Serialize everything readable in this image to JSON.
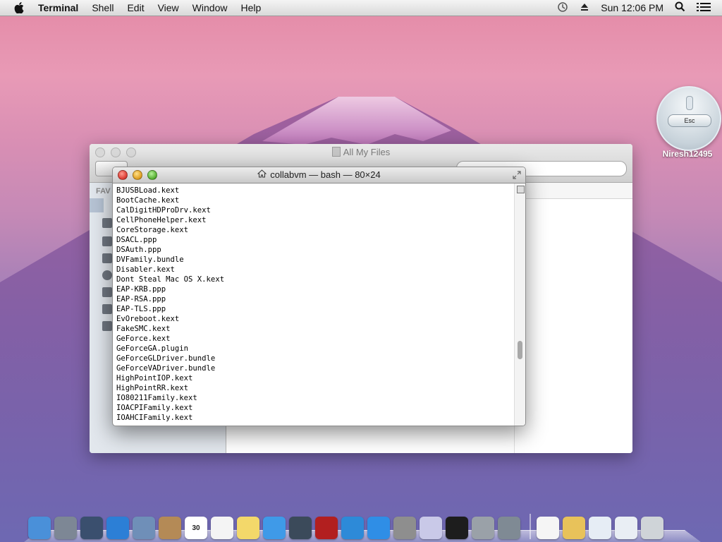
{
  "menubar": {
    "app_name": "Terminal",
    "menus": [
      "Shell",
      "Edit",
      "View",
      "Window",
      "Help"
    ],
    "clock": "Sun 12:06 PM",
    "icons": [
      "apple-icon",
      "time-machine-icon",
      "eject-icon",
      "spotlight-icon",
      "notification-list-icon"
    ]
  },
  "finder": {
    "title": "All My Files",
    "sidebar_header": "FAV"
  },
  "terminal": {
    "title": "collabvm — bash — 80×24",
    "lines": [
      "BJUSBLoad.kext",
      "BootCache.kext",
      "CalDigitHDProDrv.kext",
      "CellPhoneHelper.kext",
      "CoreStorage.kext",
      "DSACL.ppp",
      "DSAuth.ppp",
      "DVFamily.bundle",
      "Disabler.kext",
      "Dont Steal Mac OS X.kext",
      "EAP-KRB.ppp",
      "EAP-RSA.ppp",
      "EAP-TLS.ppp",
      "EvOreboot.kext",
      "FakeSMC.kext",
      "GeForce.kext",
      "GeForceGA.plugin",
      "GeForceGLDriver.bundle",
      "GeForceVADriver.bundle",
      "HighPointIOP.kext",
      "HighPointRR.kext",
      "IO80211Family.kext",
      "IOACPIFamily.kext",
      "IOAHCIFamily.kext"
    ]
  },
  "hud": {
    "esc_label": "Esc",
    "username": "Niresh12495"
  },
  "dock": {
    "items": [
      {
        "name": "finder",
        "color": "#4a90d9"
      },
      {
        "name": "launchpad",
        "color": "#7d8795"
      },
      {
        "name": "mission-control",
        "color": "#3a4f6e"
      },
      {
        "name": "safari",
        "color": "#2c7fd6"
      },
      {
        "name": "mail",
        "color": "#6f8fb8"
      },
      {
        "name": "contacts",
        "color": "#b48a56"
      },
      {
        "name": "calendar",
        "color": "#ffffff",
        "text": "30"
      },
      {
        "name": "reminders",
        "color": "#f4f4f4"
      },
      {
        "name": "notes",
        "color": "#f3d86a"
      },
      {
        "name": "messages",
        "color": "#3f9ae8"
      },
      {
        "name": "facetime",
        "color": "#3b4a5a"
      },
      {
        "name": "photo-booth",
        "color": "#b21f1f"
      },
      {
        "name": "itunes",
        "color": "#2d8ad8"
      },
      {
        "name": "app-store",
        "color": "#2f8ee6"
      },
      {
        "name": "system-preferences",
        "color": "#8e8e8e"
      },
      {
        "name": "wizard",
        "color": "#c9c9e8"
      },
      {
        "name": "terminal",
        "color": "#1d1d1d"
      },
      {
        "name": "installer",
        "color": "#9aa1a8"
      },
      {
        "name": "utility",
        "color": "#7f8a94"
      }
    ],
    "right_items": [
      {
        "name": "document",
        "color": "#f5f5f5"
      },
      {
        "name": "stack",
        "color": "#e8c25a"
      },
      {
        "name": "downloads",
        "color": "#e6edf5"
      },
      {
        "name": "folder",
        "color": "#e9eef4"
      },
      {
        "name": "trash",
        "color": "#cfd4d8"
      }
    ]
  }
}
